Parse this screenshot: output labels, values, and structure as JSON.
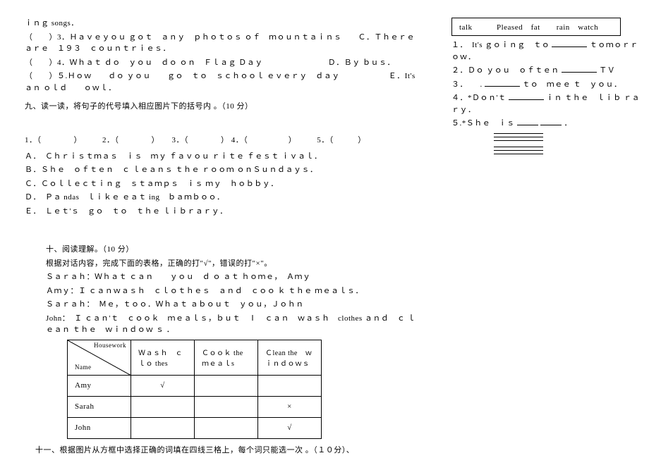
{
  "left": {
    "q3_prefix": "ｉｎｇ songs．",
    "q3": "（　　）3．Ｈａｖｅｙｏｕ ｇｏｔ　ａｎｙ　ｐｈｏｔｏｓ ｏｆ　ｍｏｕｎｔａｉｎｓ　　Ｃ．Ｔｈｅｒｅ ａｒｅ　１９３　ｃｏｕｎｔｒｉｅｓ．",
    "q4": "（　　）4．Ｗｈａｔ ｄｏ　ｙｏｕ　ｄｏ ｏｎ　Ｆｌａｇ Ｄａｙ　　　　　　　　Ｄ．Ｂｙ ｂｕｓ．",
    "q5": "（　　）５.Ｈｏｗ　　ｄｏ ｙｏｕ　　ｇｏ　ｔｏ　ｓｃｈｏｏｌ ｅｖｅｒｙ　ｄａｙ　　　　　　Ｅ．It's ａｎ ｏｌｄ　　ｏｗｌ．",
    "section9": "九、读一读，将句子的代号填入相应图片下的括号内 。（10 分）",
    "blanks": "1．（　　　　）　　　2．（　　　　）　　3．（　　　　） 4．（　　　　　）　　　5．（　　　）",
    "optA": "Ａ．　Ｃｈｒｉｓｔｍａｓ　ｉｓ　ｍｙ ｆａｖｏｕ ｒｉｔｅ ｆｅｓｔ ｉｖａｌ．",
    "optB": "Ｂ．Ｓｈｅ　ｏｆｔｅｎ　ｃ ｌｅａｎｓ ｔｈｅ ｒｏｏｍ ｏｎＳｕｎｄａｙｓ．",
    "optC": "Ｃ．Ｃｏｌｌｅｃｔｉｎｇ　ｓｔａｍｐｓ　ｉｓ ｍｙ　ｈｏｂｂｙ．",
    "optD": "Ｄ．　Ｐａ ndas　ｌｉｋｅ ｅａｔ ing　ｂａｍｂｏｏ．",
    "optE": "Ｅ．　Ｌｅｔ'ｓ　ｇｏ　ｔｏ　ｔｈｅ ｌｉｂｒａｒｙ．",
    "section10": "十、阅读理解。（10 分）",
    "instr10": "根据对话内容，完成下面的表格，正确的打\"√\"，错误的打\"×\"。",
    "dialog1": "Ｓａｒａｈ：Ｗｈａｔ ｃａｎ　　ｙｏｕ　ｄ ｏ ａｔ ｈｏｍｅ，　Ａｍｙ",
    "dialog2": "Ａｍｙ：Ｉ ｃａｎｗａｓｈ　ｃｌｏｔｈｅｓ　ａｎｄ　ｃｏｏ ｋ ｔｈｅ ｍｅａｌｓ．",
    "dialog3": "Ｓａｒａｈ：　Ｍｅ，ｔｏｏ．Ｗｈａｔ ａｂｏｕｔ　ｙｏｕ，Ｊｏｈｎ",
    "dialog4": "John：　Ｉ ｃａｎ'ｔ　ｃｏｏｋ　ｍｅａｌｓ，ｂｕｔ　Ⅰ　ｃａｎ　ｗａｓｈ　clothes ａｎｄ　ｃ ｌｅａｎ ｔｈｅ　ｗｉｎｄｏｗ ｓ ．",
    "table": {
      "diag_top": "Housework",
      "diag_bottom": "Name",
      "col1": "Ｗａｓｈ　ｃｌｏ thes",
      "col2": "Ｃｏｏｋ the ｍｅａｌs",
      "col3": "Ｃlean the　ｗｉｎｄｏｗｓ",
      "row1": "Amy",
      "row2": "Sarah",
      "row3": "John",
      "check": "√",
      "cross": "×"
    },
    "section11": "十一、根据图片从方框中选择正确的词填在四线三格上，每个词只能选一次 。（１０分）、"
  },
  "right": {
    "words": "talk　　　Pleased　fat　　rain　watch",
    "s1a": "１．　It's ｇｏｉｎｇ　ｔｏ",
    "s1b": "ｔｏｍｏｒｒｏｗ．",
    "s2a": "２．Ｄｏ ｙｏｕ　ｏｆｔｅｎ",
    "s2b": "ＴＶ",
    "s3a": "３．　　.",
    "s3b": "ｔｏ　ｍｅｅ ｔ　ｙｏｕ．",
    "s4a": "４．*Ｄｏｎ'ｔ",
    "s4b": "ｉｎ ｔｈｅ　ｌｉｂ ｒａｒｙ．",
    "s5a": "５.*Ｓｈｅ　ｉｓ",
    "s5b": "．"
  }
}
